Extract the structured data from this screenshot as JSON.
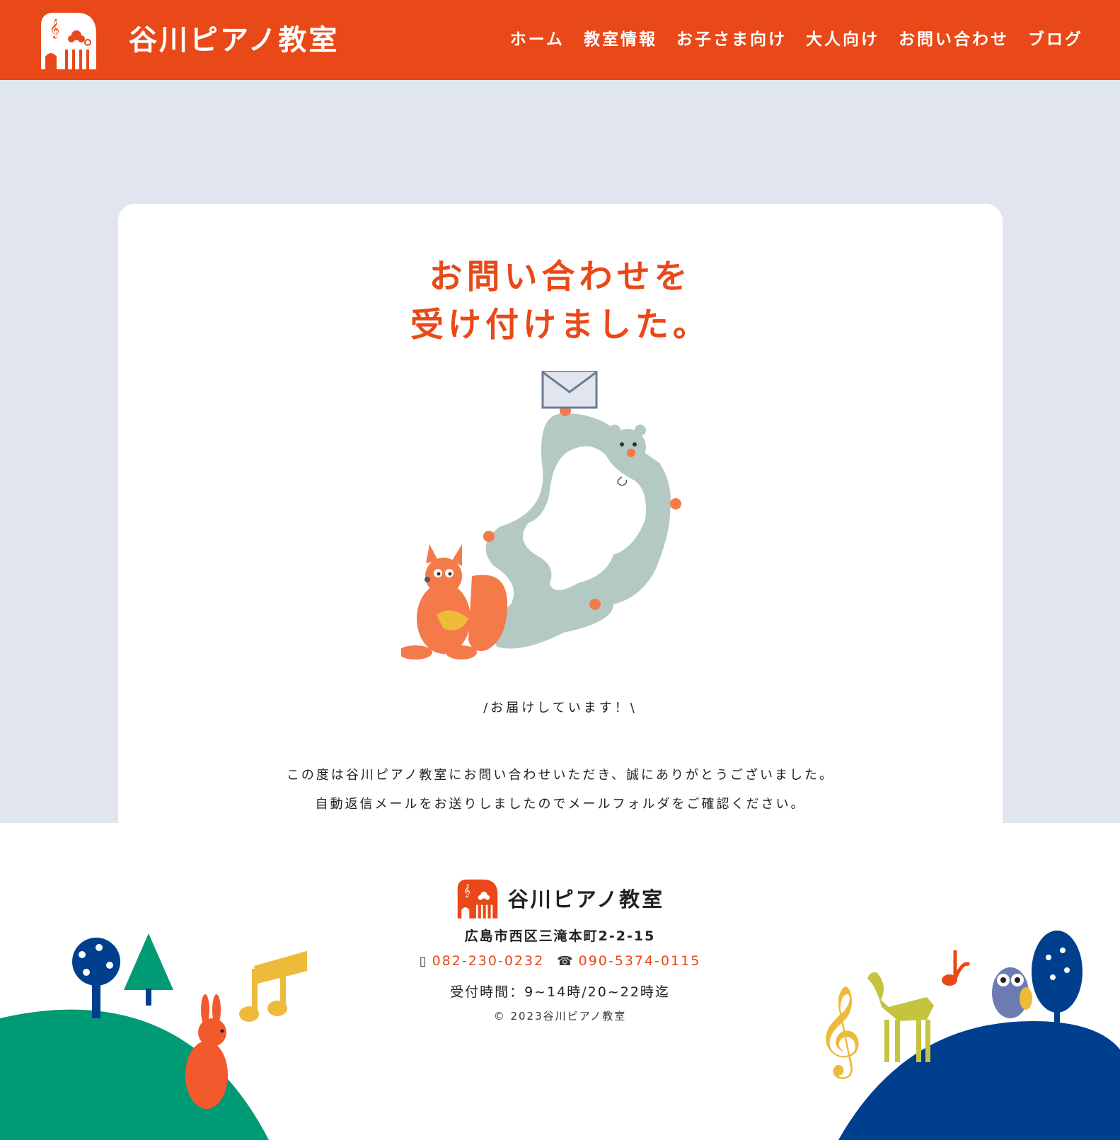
{
  "header": {
    "site_title": "谷川ピアノ教室",
    "logo_icon": "piano-house-logo-icon"
  },
  "nav": {
    "items": [
      {
        "label": "ホーム"
      },
      {
        "label": "教室情報"
      },
      {
        "label": "お子さま向け"
      },
      {
        "label": "大人向け"
      },
      {
        "label": "お問い合わせ"
      },
      {
        "label": "ブログ"
      }
    ]
  },
  "main": {
    "heading_line1": "お問い合わせを",
    "heading_line2": "受け付けました。",
    "illustration": "squirrels-delivering-envelope-illustration",
    "tagline": "/お届けしています！\\",
    "message_line1": "この度は谷川ピアノ教室にお問い合わせいただき、誠にありがとうございました。",
    "message_line2": "自動返信メールをお送りしましたのでメールフォルダをご確認ください。"
  },
  "footer": {
    "title": "谷川ピアノ教室",
    "address": "広島市西区三滝本町2-2-15",
    "phone1": "082-230-0232",
    "phone1_icon": "mobile-phone-icon",
    "phone2": "090-5374-0115",
    "phone2_icon": "telephone-icon",
    "hours": "受付時間：9~14時/20~22時迄",
    "copyright": "© 2023谷川ピアノ教室"
  },
  "colors": {
    "brand": "#e94818",
    "main_bg": "#e1e6ee",
    "hill_green": "#009a74",
    "hill_blue": "#003f8e",
    "note_yellow": "#eeba3a"
  }
}
